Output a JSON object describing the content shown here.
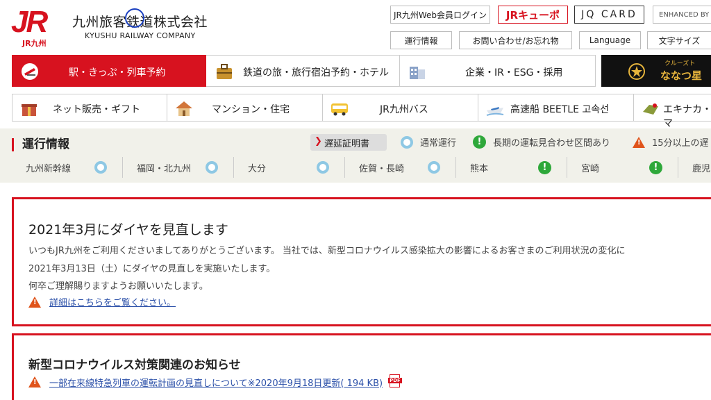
{
  "header": {
    "logo_text": "JR",
    "logo_sub": "JR九州",
    "company_jp": "九州旅客鉄道株式会社",
    "company_en": "KYUSHU RAILWAY COMPANY",
    "buttons": {
      "member_login": "JR九州Web会員ログイン",
      "jr_kyupo": "JRキューポ",
      "jq_card": "JQ CARD",
      "enhanced": "ENHANCED BY",
      "operation": "運行情報",
      "inquiry": "お問い合わせ/お忘れ物",
      "language": "Language",
      "font_size": "文字サイズ"
    }
  },
  "nav_main": [
    {
      "label": "駅・きっぷ・列車予約"
    },
    {
      "label": "鉄道の旅・旅行宿泊予約・ホテル"
    },
    {
      "label": "企業・IR・ESG・採用"
    },
    {
      "label": "ななつ星",
      "tag": "クルーズト"
    }
  ],
  "nav_sub": [
    {
      "label": "ネット販売・ギフト"
    },
    {
      "label": "マンション・住宅"
    },
    {
      "label": "JR九州バス"
    },
    {
      "label": "高速船 BEETLE 고속선"
    },
    {
      "label": "エキナカ・マ"
    }
  ],
  "operation": {
    "title": "運行情報",
    "delay_cert": "遅延証明書",
    "legend": {
      "normal": "通常運行",
      "long_suspension": "長期の運転見合わせ区間あり",
      "delay15": "15分以上の遅"
    },
    "regions": [
      {
        "name": "九州新幹線",
        "status": "normal"
      },
      {
        "name": "福岡・北九州",
        "status": "normal"
      },
      {
        "name": "大分",
        "status": "normal"
      },
      {
        "name": "佐賀・長崎",
        "status": "normal"
      },
      {
        "name": "熊本",
        "status": "long"
      },
      {
        "name": "宮崎",
        "status": "long"
      },
      {
        "name": "鹿児",
        "status": ""
      }
    ]
  },
  "notice1": {
    "title": "2021年3月にダイヤを見直します",
    "line1": "いつもJR九州をご利用くださいましてありがとうございます。 当社では、新型コロナウイルス感染拡大の影響によるお客さまのご利用状況の変化に",
    "line2": "2021年3月13日（土）にダイヤの見直しを実施いたします。",
    "line3": "何卒ご理解賜りますようお願いいたします。",
    "link": "詳細はこちらをご覧ください。"
  },
  "notice2": {
    "title": "新型コロナウイルス対策関連のお知らせ",
    "link1": "一部在来線特急列車の運転計画の見直しについて※2020年9月18日更新( 194 KB)",
    "pdf_label": "PDF"
  },
  "colors": {
    "brand_red": "#d7121f",
    "normal_ring": "#8ec8e4",
    "long_green": "#2ea83a",
    "delay_orange": "#e0541b"
  }
}
